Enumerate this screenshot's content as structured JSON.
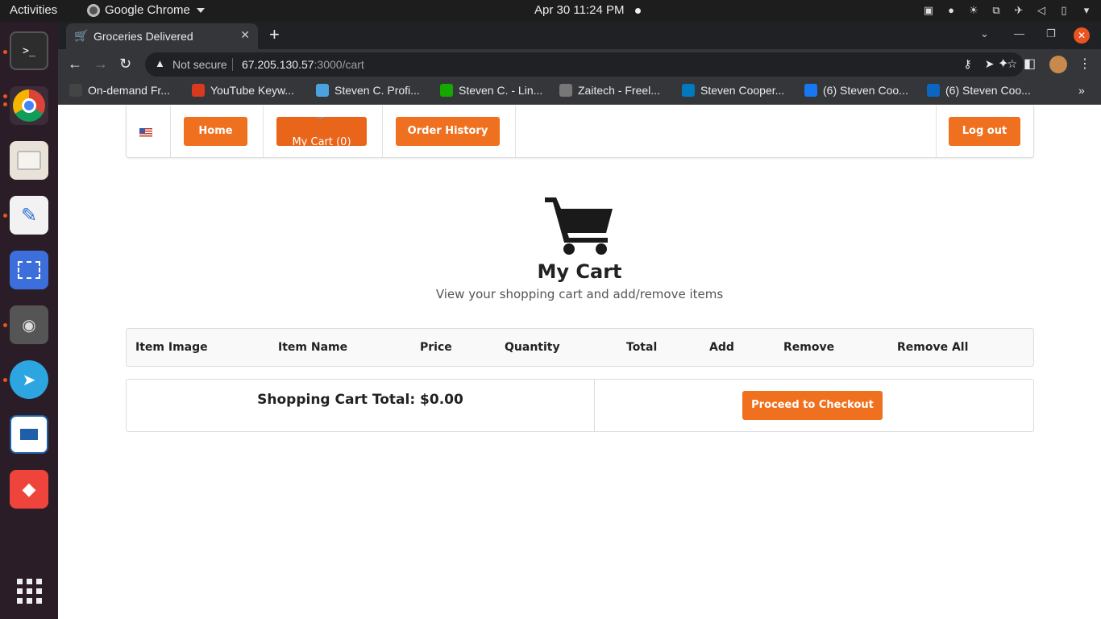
{
  "system": {
    "activities": "Activities",
    "app_name": "Google Chrome",
    "clock": "Apr 30  11:24 PM"
  },
  "browser": {
    "tab_title": "Groceries Delivered",
    "security_label": "Not secure",
    "url_host": "67.205.130.57",
    "url_path": ":3000/cart",
    "bookmarks": [
      {
        "label": "On-demand Fr...",
        "color": "#444444"
      },
      {
        "label": "YouTube Keyw...",
        "color": "#d9391f"
      },
      {
        "label": "Steven C. Profi...",
        "color": "#4aa3df"
      },
      {
        "label": "Steven C. - Lin...",
        "color": "#14a800"
      },
      {
        "label": "Zaitech - Freel...",
        "color": "#777777"
      },
      {
        "label": "Steven Cooper...",
        "color": "#0079bf"
      },
      {
        "label": "(6) Steven Coo...",
        "color": "#1877f2"
      },
      {
        "label": "(6) Steven Coo...",
        "color": "#0a66c2"
      }
    ]
  },
  "nav": {
    "home": "Home",
    "cart_label": "My Cart (0)",
    "order_history": "Order History",
    "logout": "Log out"
  },
  "cart": {
    "title": "My Cart",
    "subtitle": "View your shopping cart and add/remove items",
    "columns": [
      "Item Image",
      "Item Name",
      "Price",
      "Quantity",
      "Total",
      "Add",
      "Remove",
      "Remove All"
    ],
    "total_label": "Shopping Cart Total: $0.00",
    "checkout": "Proceed to Checkout"
  },
  "colors": {
    "accent": "#ef7120"
  }
}
